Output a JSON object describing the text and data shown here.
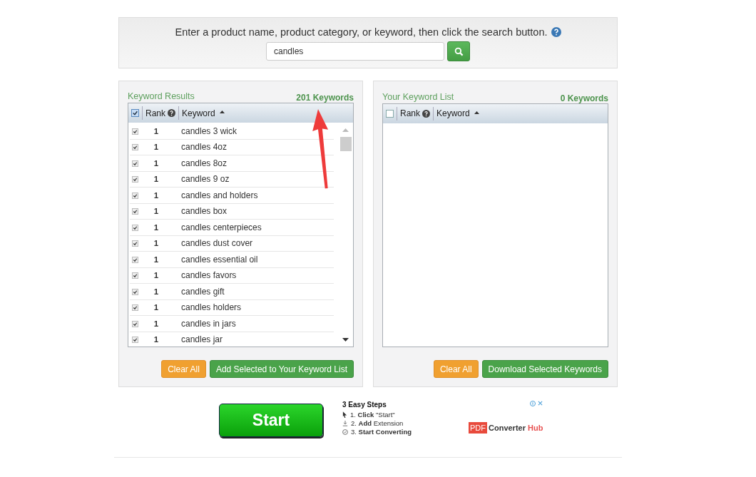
{
  "search": {
    "prompt": "Enter a product name, product category, or keyword, then click the search button.",
    "value": "candles"
  },
  "results_panel": {
    "title": "Keyword Results",
    "count": "201 Keywords",
    "header": {
      "checked": true,
      "columns": [
        "Rank",
        "Keyword"
      ]
    },
    "rows": [
      {
        "checked": true,
        "rank": "1",
        "keyword": "candles 3 wick"
      },
      {
        "checked": true,
        "rank": "1",
        "keyword": "candles 4oz"
      },
      {
        "checked": true,
        "rank": "1",
        "keyword": "candles 8oz"
      },
      {
        "checked": true,
        "rank": "1",
        "keyword": "candles 9 oz"
      },
      {
        "checked": true,
        "rank": "1",
        "keyword": "candles and holders"
      },
      {
        "checked": true,
        "rank": "1",
        "keyword": "candles box"
      },
      {
        "checked": true,
        "rank": "1",
        "keyword": "candles centerpieces"
      },
      {
        "checked": true,
        "rank": "1",
        "keyword": "candles dust cover"
      },
      {
        "checked": true,
        "rank": "1",
        "keyword": "candles essential oil"
      },
      {
        "checked": true,
        "rank": "1",
        "keyword": "candles favors"
      },
      {
        "checked": true,
        "rank": "1",
        "keyword": "candles gift"
      },
      {
        "checked": true,
        "rank": "1",
        "keyword": "candles holders"
      },
      {
        "checked": true,
        "rank": "1",
        "keyword": "candles in jars"
      },
      {
        "checked": true,
        "rank": "1",
        "keyword": "candles jar"
      }
    ],
    "buttons": [
      "Clear All",
      "Add Selected to Your Keyword List"
    ]
  },
  "list_panel": {
    "title": "Your Keyword List",
    "count": "0 Keywords",
    "header": {
      "checked": false,
      "columns": [
        "Rank",
        "Keyword"
      ]
    },
    "buttons": [
      "Clear All",
      "Download Selected Keywords"
    ]
  },
  "ad": {
    "button": "Start",
    "heading": "3 Easy Steps",
    "steps": [
      {
        "kind": "click",
        "text": "1. **Click** \"Start\""
      },
      {
        "kind": "download",
        "text": "2. **Add** Extension"
      },
      {
        "kind": "check",
        "text": "3. **Start Converting**"
      }
    ],
    "logo_badge": "PDF",
    "logo_text": "Converter",
    "logo_accent": "Hub"
  }
}
